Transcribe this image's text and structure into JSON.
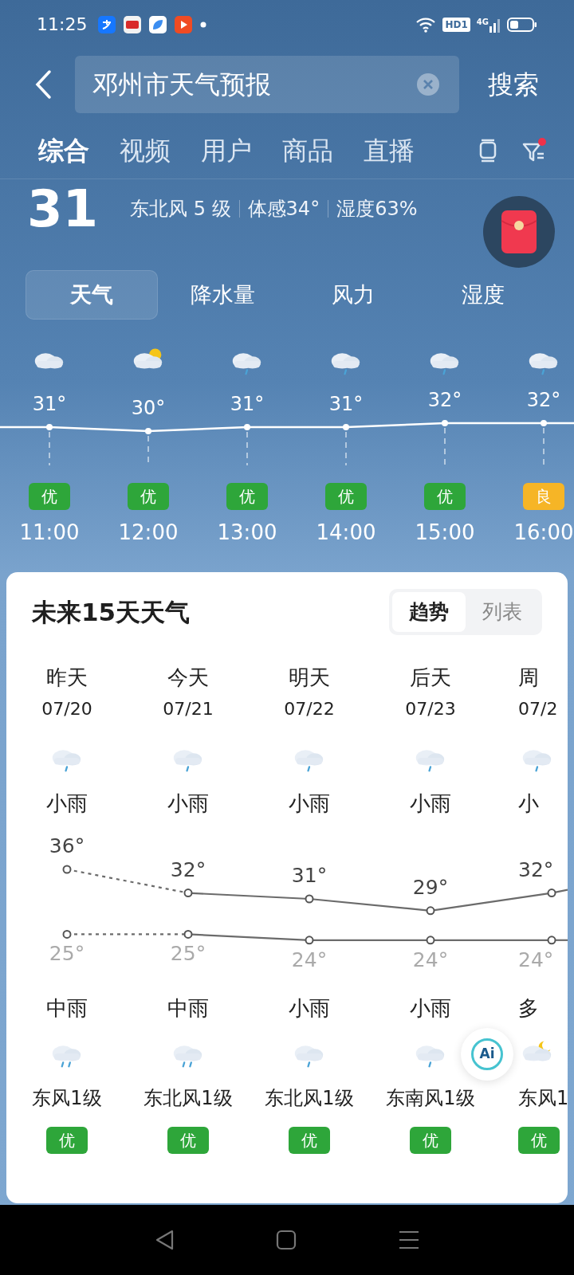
{
  "status_bar": {
    "time": "11:25",
    "hd_label": "HD1",
    "network": "4G"
  },
  "search": {
    "value": "邓州市天气预报",
    "button": "搜索"
  },
  "tabs": [
    {
      "label": "综合",
      "selected": true
    },
    {
      "label": "视频",
      "selected": false
    },
    {
      "label": "用户",
      "selected": false
    },
    {
      "label": "商品",
      "selected": false
    },
    {
      "label": "直播",
      "selected": false
    }
  ],
  "current": {
    "temperature": "31",
    "details": [
      "东北风 5 级",
      "体感34°",
      "湿度63%"
    ]
  },
  "hourly_tabs": [
    {
      "label": "天气",
      "selected": true
    },
    {
      "label": "降水量",
      "selected": false
    },
    {
      "label": "风力",
      "selected": false
    },
    {
      "label": "湿度",
      "selected": false
    }
  ],
  "hourly": [
    {
      "kind": "cloudy",
      "temp": "31°",
      "aqi": {
        "label": "优",
        "color": "#2ea63a"
      },
      "time": "11:00"
    },
    {
      "kind": "partly_sunny",
      "temp": "30°",
      "aqi": {
        "label": "优",
        "color": "#2ea63a"
      },
      "time": "12:00"
    },
    {
      "kind": "light_rain",
      "temp": "31°",
      "aqi": {
        "label": "优",
        "color": "#2ea63a"
      },
      "time": "13:00"
    },
    {
      "kind": "light_rain",
      "temp": "31°",
      "aqi": {
        "label": "优",
        "color": "#2ea63a"
      },
      "time": "14:00"
    },
    {
      "kind": "light_rain",
      "temp": "32°",
      "aqi": {
        "label": "优",
        "color": "#2ea63a"
      },
      "time": "15:00"
    },
    {
      "kind": "light_rain",
      "temp": "32°",
      "aqi": {
        "label": "良",
        "color": "#f6b526"
      },
      "time": "16:00"
    }
  ],
  "forecast": {
    "title": "未来15天天气",
    "view_tabs": [
      {
        "label": "趋势",
        "selected": true
      },
      {
        "label": "列表",
        "selected": false
      }
    ],
    "days": [
      {
        "day": "昨天",
        "date": "07/20",
        "past": true,
        "daytime": {
          "kind": "light_rain",
          "weather": "小雨"
        },
        "high": "36°",
        "low": "25°",
        "night": {
          "kind": "moderate_rain",
          "weather": "中雨"
        },
        "wind": "东风1级",
        "aqi": {
          "label": "优",
          "color": "#2ea63a"
        }
      },
      {
        "day": "今天",
        "date": "07/21",
        "past": false,
        "daytime": {
          "kind": "light_rain",
          "weather": "小雨"
        },
        "high": "32°",
        "low": "25°",
        "night": {
          "kind": "moderate_rain",
          "weather": "中雨"
        },
        "wind": "东北风1级",
        "aqi": {
          "label": "优",
          "color": "#2ea63a"
        }
      },
      {
        "day": "明天",
        "date": "07/22",
        "past": false,
        "daytime": {
          "kind": "light_rain",
          "weather": "小雨"
        },
        "high": "31°",
        "low": "24°",
        "night": {
          "kind": "light_rain",
          "weather": "小雨"
        },
        "wind": "东北风1级",
        "aqi": {
          "label": "优",
          "color": "#2ea63a"
        }
      },
      {
        "day": "后天",
        "date": "07/23",
        "past": false,
        "daytime": {
          "kind": "light_rain",
          "weather": "小雨"
        },
        "high": "29°",
        "low": "24°",
        "night": {
          "kind": "light_rain",
          "weather": "小雨"
        },
        "wind": "东南风1级",
        "aqi": {
          "label": "优",
          "color": "#2ea63a"
        }
      },
      {
        "day": "周",
        "date": "07/2",
        "past": false,
        "daytime": {
          "kind": "light_rain",
          "weather": "小"
        },
        "high": "32°",
        "low": "24°",
        "night": {
          "kind": "cloudy_night",
          "weather": "多"
        },
        "wind": "东风1",
        "aqi": {
          "label": "优",
          "color": "#2ea63a"
        }
      }
    ]
  },
  "ai_button": {
    "label": "Ai"
  }
}
